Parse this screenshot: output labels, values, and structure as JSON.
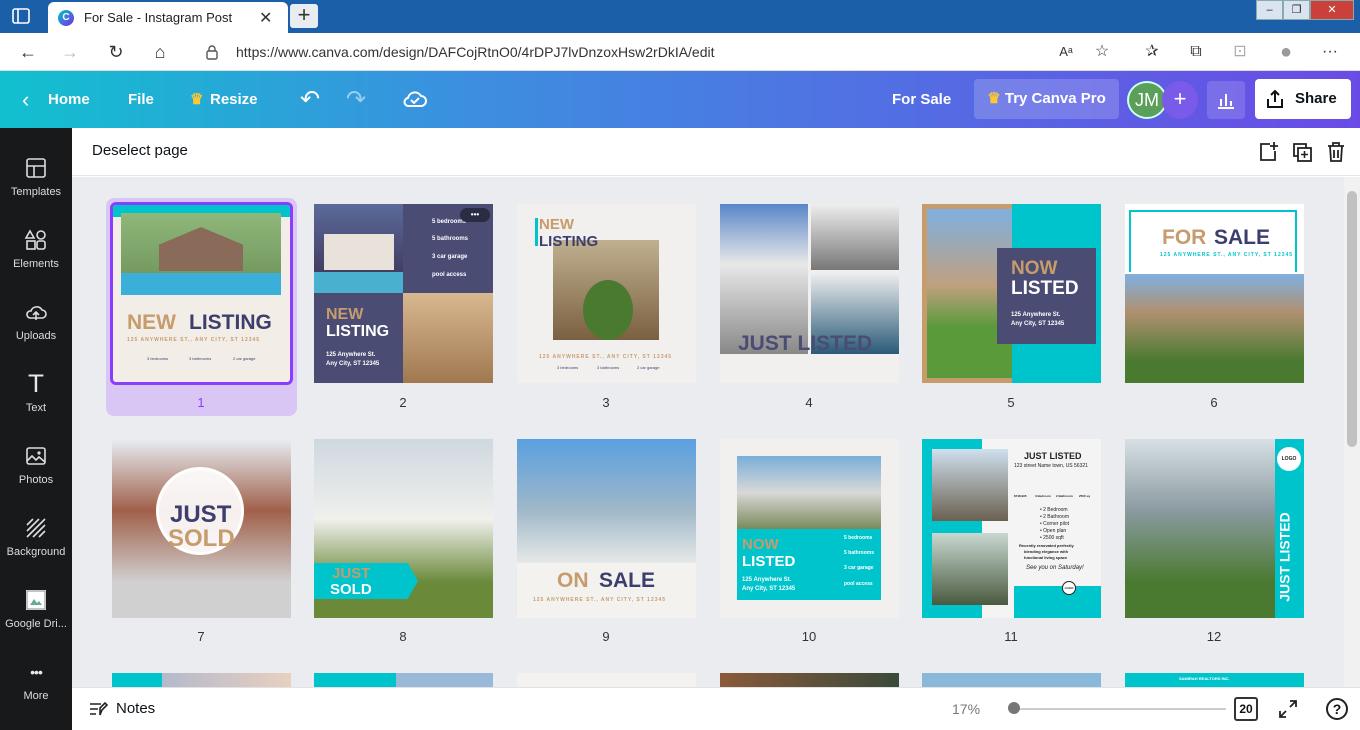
{
  "browser": {
    "tab_title": "For Sale - Instagram Post",
    "tab_favicon": "C",
    "close_tab": "✕",
    "new_tab": "+",
    "url": "https://www.canva.com/design/DAFCojRtnO0/4rDPJ7lvDnzoxHsw2rDkIA/edit",
    "win_min": "–",
    "win_max": "❐",
    "win_close": "✕",
    "back": "←",
    "forward": "→",
    "refresh": "↻",
    "home": "⌂",
    "read_aloud": "Aᵃ",
    "fav_star": "☆",
    "favorites": "✰",
    "collections": "⧉",
    "extensions": "⊡",
    "profile": "●",
    "more": "···"
  },
  "header": {
    "back_arrow": "‹",
    "home": "Home",
    "file": "File",
    "crown": "♛",
    "resize": "Resize",
    "undo": "↶",
    "redo": "↷",
    "design_name": "For Sale",
    "try_pro": "Try Canva Pro",
    "avatar": "JM",
    "add": "+",
    "share": "Share"
  },
  "sidebar": {
    "items": [
      {
        "label": "Templates",
        "icon": "templates-icon"
      },
      {
        "label": "Elements",
        "icon": "elements-icon"
      },
      {
        "label": "Uploads",
        "icon": "uploads-icon"
      },
      {
        "label": "Text",
        "icon": "text-icon"
      },
      {
        "label": "Photos",
        "icon": "photos-icon"
      },
      {
        "label": "Background",
        "icon": "background-icon"
      },
      {
        "label": "Google Dri...",
        "icon": "google-drive-icon"
      },
      {
        "label": "More",
        "icon": "more-icon"
      }
    ],
    "text_glyph": "T",
    "more_glyph": "•••"
  },
  "toolbar": {
    "deselect": "Deselect page"
  },
  "pages": [
    {
      "number": "1"
    },
    {
      "number": "2"
    },
    {
      "number": "3"
    },
    {
      "number": "4"
    },
    {
      "number": "5"
    },
    {
      "number": "6"
    },
    {
      "number": "7"
    },
    {
      "number": "8"
    },
    {
      "number": "9"
    },
    {
      "number": "10"
    },
    {
      "number": "11"
    },
    {
      "number": "12"
    }
  ],
  "designs": {
    "p1": {
      "new": "NEW",
      "listing": "LISTING",
      "addr": "125 ANYWHERE ST., ANY CITY, ST 12345",
      "f1": "3 bedrooms",
      "f2": "3 bathrooms",
      "f3": "2 car garage"
    },
    "p2": {
      "new": "NEW",
      "listing": "LISTING",
      "addr1": "125 Anywhere St.",
      "addr2": "Any City, ST 12345",
      "f1": "5 bedrooms",
      "f2": "5 bathrooms",
      "f3": "3 car garage",
      "f4": "pool access",
      "menu": "•••"
    },
    "p3": {
      "new": "NEW",
      "listing": "LISTING",
      "addr": "125 ANYWHERE ST., ANY CITY, ST 12345",
      "f1": "3 bedrooms",
      "f2": "3 bathrooms",
      "f3": "2 car garage"
    },
    "p4": {
      "title": "JUST LISTED"
    },
    "p5": {
      "now": "NOW",
      "listed": "LISTED",
      "addr1": "125 Anywhere St.",
      "addr2": "Any City, ST 12345"
    },
    "p6": {
      "for": "FOR",
      "sale": "SALE",
      "addr": "125 ANYWHERE ST., ANY CITY, ST 12345"
    },
    "p7": {
      "just": "JUST",
      "sold": "SOLD"
    },
    "p8": {
      "just": "JUST",
      "sold": "SOLD"
    },
    "p9": {
      "on": "ON",
      "sale": "SALE",
      "addr": "125 ANYWHERE ST., ANY CITY, ST 12345"
    },
    "p10": {
      "now": "NOW",
      "listed": "LISTED",
      "addr1": "125 Anywhere St.",
      "addr2": "Any City, ST 12345",
      "f1": "5 bedrooms",
      "f2": "5 bathrooms",
      "f3": "3 car garage",
      "f4": "pool access"
    },
    "p11": {
      "title": "JUST LISTED",
      "addr": "123 street Name town, US 56321",
      "p1": "$748,995",
      "p2": "3 Bedroom",
      "p3": "2 Bathroom",
      "p4": "2500 sq",
      "b1": "• 2 Bedroom",
      "b2": "• 2 Bathroom",
      "b3": "• Corner pilot",
      "b4": "• Open plan",
      "b5": "• 2500 sqft",
      "desc1": "Recently renovated perfectly",
      "desc2": "blending elegance with",
      "desc3": "functional living space",
      "script": "See you on Saturday!",
      "logo": "LOGO"
    },
    "p12": {
      "vert": "JUST LISTED",
      "logo": "LOGO"
    },
    "row3_label": "SAMIRAH REALTORS INC."
  },
  "bottom": {
    "notes": "Notes",
    "zoom": "17%",
    "page_count": "20",
    "help": "?"
  },
  "colors": {
    "accent": "#8b3dff",
    "teal": "#00c4cc",
    "navy": "#3c3f6e",
    "tan": "#c69c6d"
  }
}
